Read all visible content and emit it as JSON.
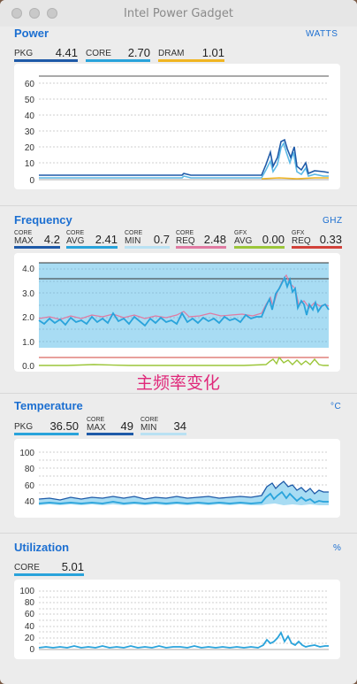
{
  "window": {
    "title": "Intel Power Gadget"
  },
  "power": {
    "title": "Power",
    "unit": "WATTS",
    "metrics": [
      {
        "label": "PKG",
        "value": "4.41",
        "color": "#1e5aa8"
      },
      {
        "label": "CORE",
        "value": "2.70",
        "color": "#29a3db"
      },
      {
        "label": "DRAM",
        "value": "1.01",
        "color": "#f0b522"
      }
    ],
    "ticks": [
      "60",
      "50",
      "40",
      "30",
      "20",
      "10",
      "0"
    ]
  },
  "frequency": {
    "title": "Frequency",
    "unit": "GHZ",
    "metrics": [
      {
        "sup": "CORE",
        "label": "MAX",
        "value": "4.2",
        "color": "#1e5aa8"
      },
      {
        "sup": "CORE",
        "label": "AVG",
        "value": "2.41",
        "color": "#29a3db"
      },
      {
        "sup": "CORE",
        "label": "MIN",
        "value": "0.7",
        "color": "#b9e1f3"
      },
      {
        "sup": "CORE",
        "label": "REQ",
        "value": "2.48",
        "color": "#e07aa2"
      },
      {
        "sup": "GFX",
        "label": "AVG",
        "value": "0.00",
        "color": "#9cc63a"
      },
      {
        "sup": "GFX",
        "label": "REQ",
        "value": "0.33",
        "color": "#d2423a"
      }
    ],
    "ticks": [
      "4.0",
      "3.0",
      "2.0",
      "1.0",
      "0.0"
    ],
    "annotation": "主频率变化"
  },
  "temperature": {
    "title": "Temperature",
    "unit": "°C",
    "metrics": [
      {
        "label": "PKG",
        "value": "36.50",
        "color": "#29a3db"
      },
      {
        "sup": "CORE",
        "label": "MAX",
        "value": "49",
        "color": "#1e5aa8"
      },
      {
        "sup": "CORE",
        "label": "MIN",
        "value": "34",
        "color": "#b9e1f3"
      }
    ],
    "ticks": [
      "100",
      "80",
      "60",
      "40"
    ]
  },
  "utilization": {
    "title": "Utilization",
    "unit": "%",
    "metrics": [
      {
        "label": "CORE",
        "value": "5.01",
        "color": "#29a3db"
      }
    ],
    "ticks": [
      "100",
      "80",
      "60",
      "40",
      "20",
      "0"
    ]
  }
}
